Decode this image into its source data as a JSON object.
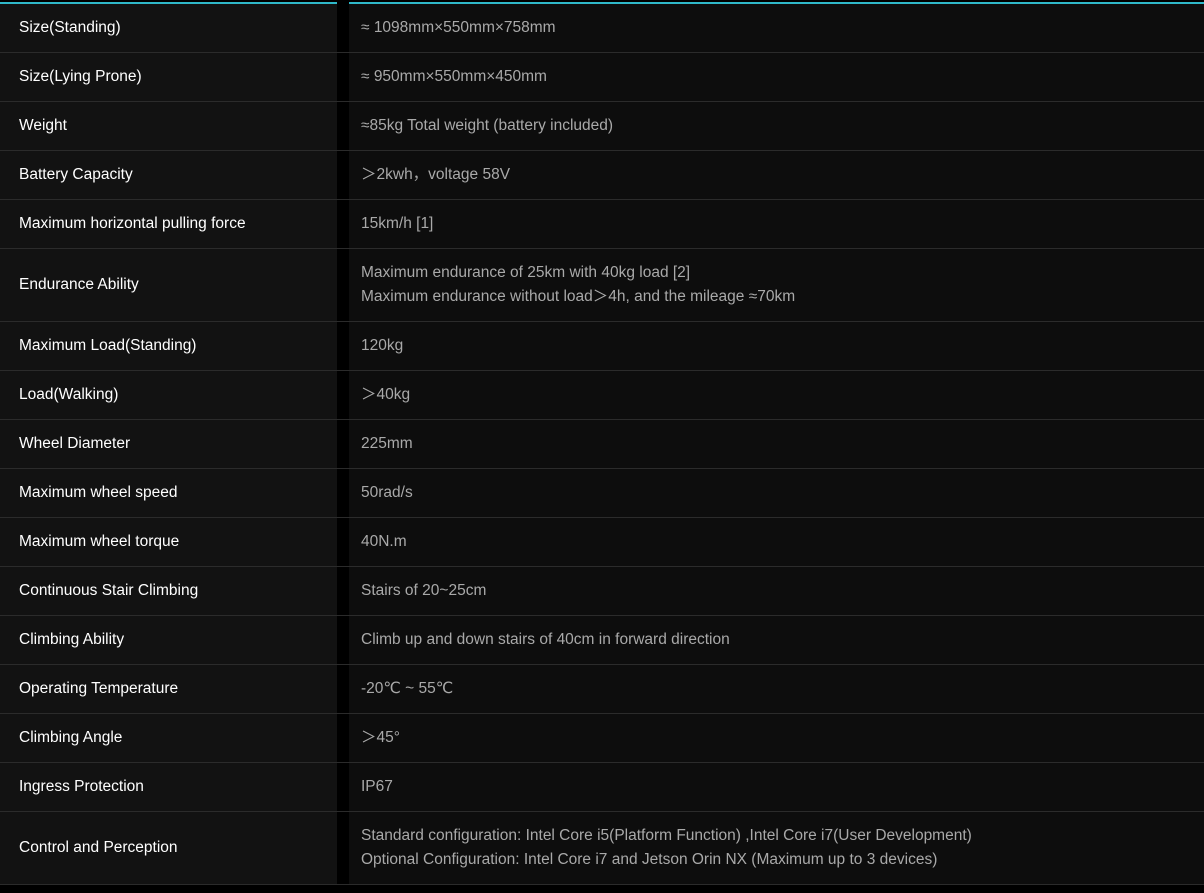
{
  "colors": {
    "accent": "#2fb8c9",
    "background": "#000000",
    "label_bg": "#121212",
    "value_bg": "#0d0d0d",
    "label_text": "#ffffff",
    "value_text": "#a9a9a9"
  },
  "specs": [
    {
      "label": "Size(Standing)",
      "lines": [
        "≈ 1098mm×550mm×758mm"
      ]
    },
    {
      "label": "Size(Lying Prone)",
      "lines": [
        "≈ 950mm×550mm×450mm"
      ]
    },
    {
      "label": "Weight",
      "lines": [
        "≈85kg Total weight (battery included)"
      ]
    },
    {
      "label": "Battery Capacity",
      "lines": [
        "＞2kwh，voltage 58V"
      ]
    },
    {
      "label": "Maximum horizontal pulling force",
      "lines": [
        "15km/h [1]"
      ]
    },
    {
      "label": "Endurance Ability",
      "lines": [
        "Maximum endurance of 25km with 40kg load [2]",
        "Maximum endurance without load＞4h, and the mileage ≈70km"
      ]
    },
    {
      "label": "Maximum Load(Standing)",
      "lines": [
        "120kg"
      ]
    },
    {
      "label": "Load(Walking)",
      "lines": [
        "＞40kg"
      ]
    },
    {
      "label": "Wheel Diameter",
      "lines": [
        "225mm"
      ]
    },
    {
      "label": "Maximum wheel speed",
      "lines": [
        "50rad/s"
      ]
    },
    {
      "label": "Maximum wheel torque",
      "lines": [
        "40N.m"
      ]
    },
    {
      "label": "Continuous Stair Climbing",
      "lines": [
        "Stairs of 20~25cm"
      ]
    },
    {
      "label": "Climbing Ability",
      "lines": [
        "Climb up and down stairs of 40cm in forward direction"
      ]
    },
    {
      "label": "Operating Temperature",
      "lines": [
        "-20℃ ~ 55℃"
      ]
    },
    {
      "label": "Climbing Angle",
      "lines": [
        "＞45°"
      ]
    },
    {
      "label": "Ingress Protection",
      "lines": [
        "IP67"
      ]
    },
    {
      "label": "Control and Perception",
      "lines": [
        "Standard configuration: Intel Core i5(Platform Function) ,Intel Core i7(User Development)",
        "Optional Configuration: Intel Core i7 and Jetson Orin NX (Maximum up to 3 devices)"
      ]
    }
  ]
}
